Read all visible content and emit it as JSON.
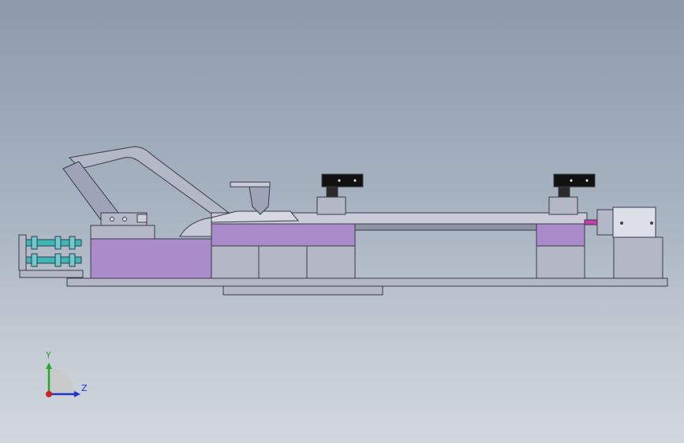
{
  "viewport": {
    "background_top": "#8c9aab",
    "background_bottom": "#d2d7dd"
  },
  "colors": {
    "purple_block": "#a98bc9",
    "gray_part": "#b4b7c6",
    "dark_outline": "#3a3a4a",
    "rail": "#8e93a3",
    "cyan_bolt": "#3fb6b6",
    "black_clamp": "#111111",
    "magenta_pin": "#c23ea8"
  },
  "triad": {
    "y_label": "Y",
    "z_label": "Z",
    "y_color": "#22aa22",
    "z_color": "#2233cc",
    "x_color": "#cc2222"
  },
  "icons": {
    "axis_triad": "axis-triad-icon"
  }
}
